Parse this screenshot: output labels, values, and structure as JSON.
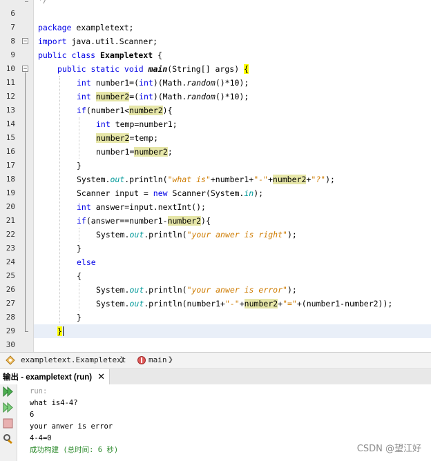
{
  "editor": {
    "line_numbers": [
      "6",
      "7",
      "8",
      "9",
      "10",
      "11",
      "12",
      "13",
      "14",
      "15",
      "16",
      "17",
      "18",
      "19",
      "20",
      "21",
      "22",
      "23",
      "24",
      "25",
      "26",
      "27",
      "28",
      "29",
      "30"
    ],
    "top_partial_text": "*/",
    "lines": {
      "l7_kw": "package",
      "l7_rest": " exampletext;",
      "l8_kw": "import",
      "l8_rest": " java.util.Scanner;",
      "l9_kw": "public class",
      "l9_name": " Exampletext",
      "l9_rest": " {",
      "l10_kw": "public static void",
      "l10_name": "main",
      "l10_args": "(String[] args) ",
      "l10_brace": "{",
      "l11_kw": "int",
      "l11_a": " number1=(",
      "l11_kw2": "int",
      "l11_b": ")(Math.",
      "l11_m": "random",
      "l11_c": "()*10);",
      "l12_kw": "int",
      "l12_sp": " ",
      "l12_var": "number2",
      "l12_a": "=(",
      "l12_kw2": "int",
      "l12_b": ")(Math.",
      "l12_m": "random",
      "l12_c": "()*10);",
      "l13_kw": "if",
      "l13_a": "(number1<",
      "l13_var": "number2",
      "l13_b": "){",
      "l14_kw": "int",
      "l14_a": " temp=number1;",
      "l15_var": "number2",
      "l15_a": "=temp;",
      "l16_a": "number1=",
      "l16_var": "number2",
      "l16_b": ";",
      "l17": "}",
      "l18_a": "System.",
      "l18_out": "out",
      "l18_b": ".println(",
      "l18_s1": "\"what is\"",
      "l18_c": "+number1+",
      "l18_s2": "\"-\"",
      "l18_d": "+",
      "l18_var": "number2",
      "l18_e": "+",
      "l18_s3": "\"?\"",
      "l18_f": ");",
      "l19_a": "Scanner input = ",
      "l19_kw": "new",
      "l19_b": " Scanner(System.",
      "l19_in": "in",
      "l19_c": ");",
      "l20_kw": "int",
      "l20_a": " answer=input.nextInt();",
      "l21_kw": "if",
      "l21_a": "(answer==number1-",
      "l21_var": "number2",
      "l21_b": "){",
      "l22_a": "System.",
      "l22_out": "out",
      "l22_b": ".println(",
      "l22_s": "\"your anwer is right\"",
      "l22_c": ");",
      "l23": "}",
      "l24_kw": "else",
      "l25": "{",
      "l26_a": "System.",
      "l26_out": "out",
      "l26_b": ".println(",
      "l26_s": "\"your anwer is error\"",
      "l26_c": ");",
      "l27_a": "System.",
      "l27_out": "out",
      "l27_b": ".println(number1+",
      "l27_s1": "\"-\"",
      "l27_c": "+",
      "l27_var": "number2",
      "l27_d": "+",
      "l27_s2": "\"=\"",
      "l27_e": "+(number1-number2));",
      "l28": "}",
      "l29_brace": "}"
    }
  },
  "breadcrumb": {
    "class_label": "exampletext.Exampletext",
    "method_label": "main"
  },
  "output": {
    "tab_label": "输出 - exampletext (run)",
    "close_symbol": "✕",
    "lines": [
      "run:",
      "what is4-4?",
      "6",
      "your anwer is error",
      "4-4=0",
      "成功构建 (总时间: 6 秒)"
    ]
  },
  "watermark": "CSDN @望江好",
  "colors": {
    "keyword": "#0000e6",
    "string": "#ce7b00",
    "field": "#009999",
    "highlight": "#e6e6a8",
    "brace_match": "#ffff00",
    "success": "#2b8a2b"
  }
}
